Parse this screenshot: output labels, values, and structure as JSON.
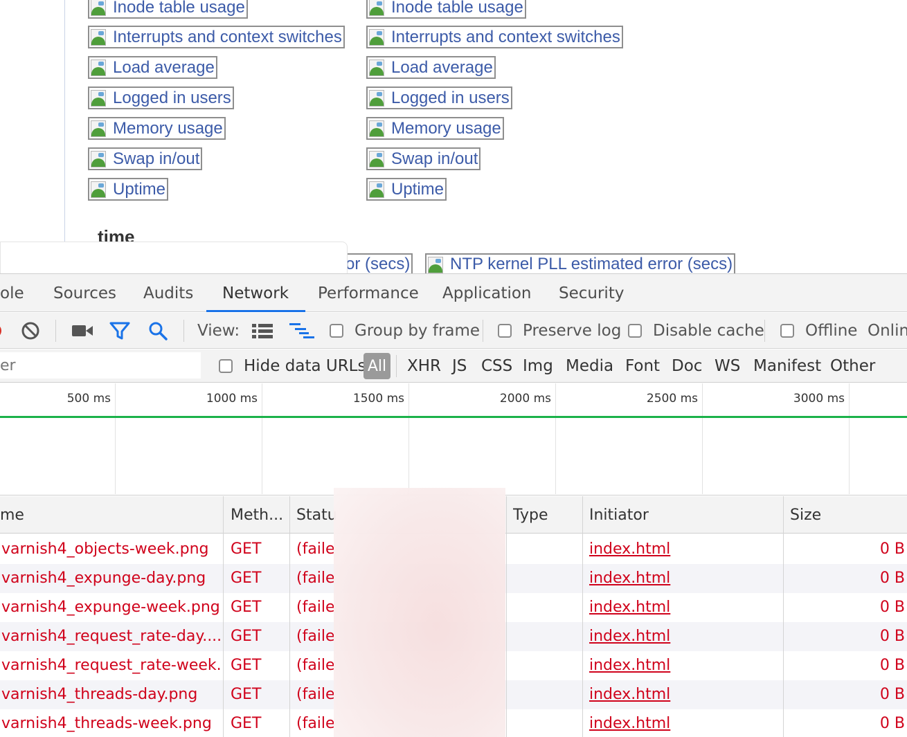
{
  "page": {
    "links_col1": [
      "Inode table usage",
      "Interrupts and context switches",
      "Load average",
      "Logged in users",
      "Memory usage",
      "Swap in/out",
      "Uptime"
    ],
    "links_col2": [
      "Inode table usage",
      "Interrupts and context switches",
      "Load average",
      "Logged in users",
      "Memory usage",
      "Swap in/out",
      "Uptime"
    ],
    "section_title": "time",
    "partial_link_1": "or (secs)",
    "partial_link_2": "NTP kernel PLL estimated error (secs)"
  },
  "devtools": {
    "tabs": [
      "ole",
      "Sources",
      "Audits",
      "Network",
      "Performance",
      "Application",
      "Security"
    ],
    "active_tab": "Network",
    "toolbar": {
      "view_label": "View:",
      "group_by_frame": "Group by frame",
      "preserve_log": "Preserve log",
      "disable_cache": "Disable cache",
      "offline": "Offline",
      "online": "Onlin"
    },
    "filter": {
      "placeholder": "er",
      "hide_data_urls": "Hide data URLs",
      "types": [
        "All",
        "XHR",
        "JS",
        "CSS",
        "Img",
        "Media",
        "Font",
        "Doc",
        "WS",
        "Manifest",
        "Other"
      ]
    },
    "timeline_ticks": [
      "500 ms",
      "1000 ms",
      "1500 ms",
      "2000 ms",
      "2500 ms",
      "3000 ms"
    ],
    "columns": [
      "me",
      "Meth...",
      "Statu",
      "Type",
      "Initiator",
      "Size"
    ],
    "rows": [
      {
        "name": "varnish4_objects-week.png",
        "method": "GET",
        "status": "(failed",
        "initiator": "index.html",
        "size": "0 B"
      },
      {
        "name": "varnish4_expunge-day.png",
        "method": "GET",
        "status": "(failed",
        "initiator": "index.html",
        "size": "0 B"
      },
      {
        "name": "varnish4_expunge-week.png",
        "method": "GET",
        "status": "(failed",
        "initiator": "index.html",
        "size": "0 B"
      },
      {
        "name": "varnish4_request_rate-day....",
        "method": "GET",
        "status": "(failed",
        "initiator": "index.html",
        "size": "0 B"
      },
      {
        "name": "varnish4_request_rate-week...",
        "method": "GET",
        "status": "(failed",
        "initiator": "index.html",
        "size": "0 B"
      },
      {
        "name": "varnish4_threads-day.png",
        "method": "GET",
        "status": "(failed",
        "initiator": "index.html",
        "size": "0 B"
      },
      {
        "name": "varnish4_threads-week.png",
        "method": "GET",
        "status": "(failed",
        "initiator": "index.html",
        "size": "0 B"
      }
    ],
    "colors": {
      "accent": "#1a73e8",
      "error_text": "#d0021b",
      "link": "#3c5ba8",
      "timeline_green": "#1bb24a"
    }
  }
}
